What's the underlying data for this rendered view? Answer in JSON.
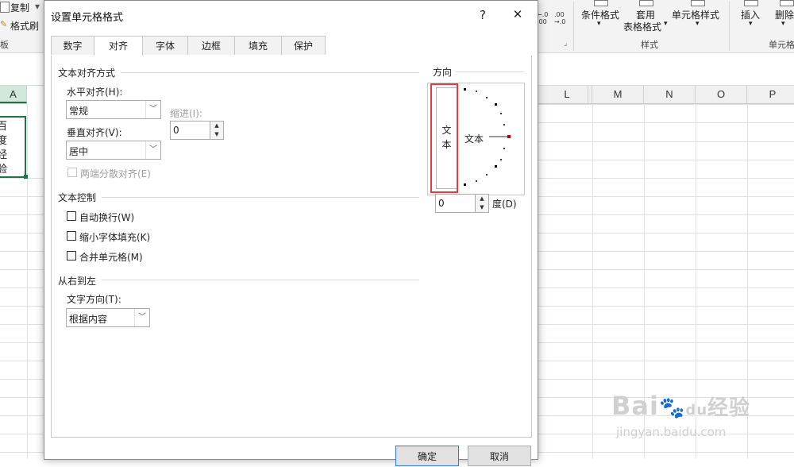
{
  "ribbon": {
    "copy_label": "复制",
    "format_painter_label": "格式刷",
    "clipboard_group_label": "板",
    "number_format_increase": "←.0\n.00",
    "number_format_decrease": ".00\n→.0",
    "conditional_format_label": "条件格式",
    "table_format_label_top": "套用",
    "table_format_label_bottom": "表格格式",
    "cell_style_label": "单元格样式",
    "styles_group_label": "样式",
    "insert_label": "插入",
    "delete_label": "删除",
    "cells_group_label": "单元格"
  },
  "sheet": {
    "column_headers": [
      "A",
      "L",
      "M",
      "N",
      "O",
      "P"
    ],
    "cell_chars": [
      "百",
      "度",
      "经",
      "验"
    ]
  },
  "dialog": {
    "title": "设置单元格格式",
    "help_label": "?",
    "close_label": "✕",
    "tabs": [
      "数字",
      "对齐",
      "字体",
      "边框",
      "填充",
      "保护"
    ],
    "active_tab": "对齐",
    "text_alignment": {
      "section_title": "文本对齐方式",
      "horizontal_label": "水平对齐(H):",
      "horizontal_value": "常规",
      "indent_label": "缩进(I):",
      "indent_value": "0",
      "vertical_label": "垂直对齐(V):",
      "vertical_value": "居中",
      "distributed_label": "两端分散对齐(E)"
    },
    "text_control": {
      "section_title": "文本控制",
      "wrap_label": "自动换行(W)",
      "shrink_label": "缩小字体填充(K)",
      "merge_label": "合并单元格(M)"
    },
    "rtl": {
      "section_title": "从右到左",
      "direction_label": "文字方向(T):",
      "direction_value": "根据内容"
    },
    "orientation": {
      "section_title": "方向",
      "vertical_text": [
        "文",
        "本"
      ],
      "horizontal_text": "文本",
      "degrees_value": "0",
      "degrees_label": "度(D)"
    },
    "ok_label": "确定",
    "cancel_label": "取消"
  },
  "watermark": {
    "brand": "Bai",
    "brand_cn": "经验",
    "url": "jingyan.baidu.com"
  },
  "colors": {
    "highlight_frame": "#e63b3b",
    "dial_marker": "#c00000",
    "selected_cell_border": "#217346"
  }
}
